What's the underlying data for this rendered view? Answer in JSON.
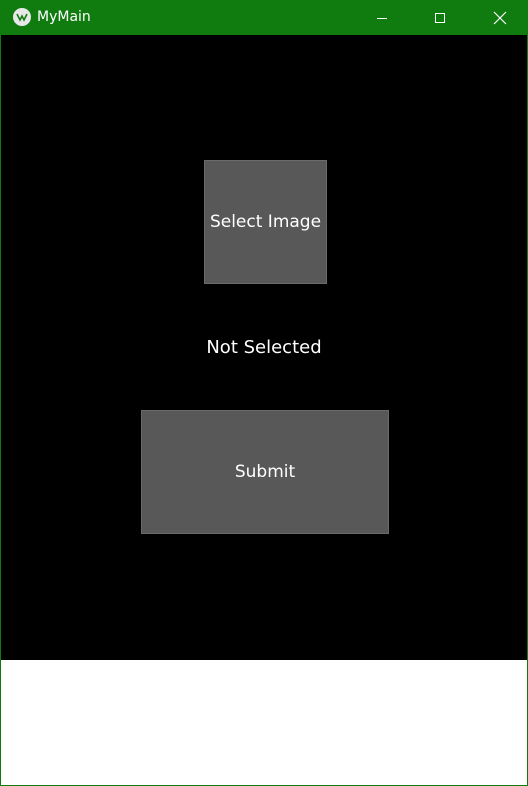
{
  "window": {
    "title": "MyMain",
    "titlebar_color": "#107c10",
    "icons": {
      "app": "kivy-app-icon",
      "minimize": "minimize-icon",
      "maximize": "maximize-icon",
      "close": "close-icon"
    }
  },
  "main": {
    "background": "#000000",
    "select_image_label": "Select Image",
    "status_text": "Not Selected",
    "submit_label": "Submit",
    "button_color": "#585858"
  }
}
